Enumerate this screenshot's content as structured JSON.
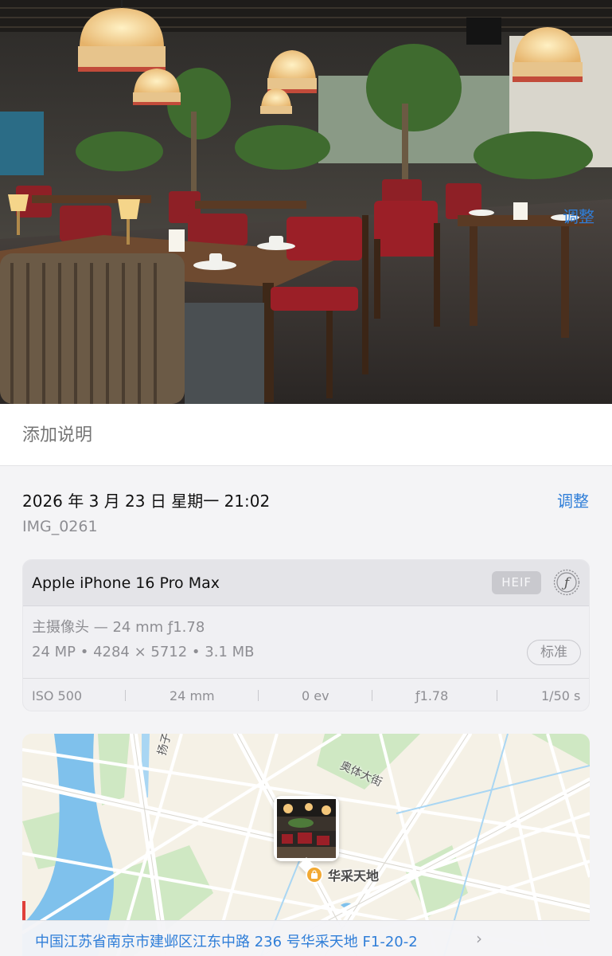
{
  "photo": {
    "alt": "restaurant interior photo"
  },
  "caption": {
    "placeholder": "添加说明"
  },
  "info": {
    "datetime": "2026 年 3 月 23 日 星期一 21:02",
    "adjust_label": "调整",
    "filename": "IMG_0261"
  },
  "metadata": {
    "device": "Apple iPhone 16 Pro Max",
    "format_badge": "HEIF",
    "lens": "主摄像头 — 24 mm ƒ1.78",
    "specs": "24 MP • 4284 × 5712 • 3.1 MB",
    "quality_badge": "标准",
    "exif": [
      "ISO 500",
      "24 mm",
      "0 ev",
      "ƒ1.78",
      "1/50 s"
    ]
  },
  "map": {
    "poi_label": "华采天地",
    "road_labels": [
      "奥体大街",
      "扬子"
    ],
    "address": "中国江苏省南京市建邺区江东中路 236 号华采天地 F1-20-2",
    "adjust_label": "调整"
  },
  "colors": {
    "accent": "#2f7ed8",
    "water": "#7fc1ec",
    "park": "#cfe8c3"
  }
}
